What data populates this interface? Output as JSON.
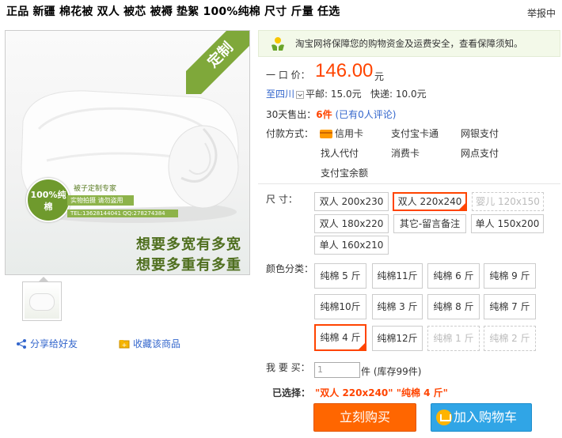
{
  "title": "正品 新疆 棉花被 双人 被芯 被褥 垫絮 100%纯棉 尺寸 斤量 任选",
  "report_link": "举报中",
  "image": {
    "ribbon": "定制",
    "badge": "100%纯棉",
    "brand_line1": "被子定制专家",
    "brand_line2": "实物拍摄 请勿盗用",
    "brand_line3": "TEL:13628144041 QQ:278274384",
    "slogan1": "想要多宽有多宽",
    "slogan2": "想要多重有多重"
  },
  "share": "分享给好友",
  "favorite": "收藏该商品",
  "guarantee": "淘宝网将保障您的购物资金及运费安全，查看保障须知。",
  "price": {
    "label": "一 口 价：",
    "value": "146.00",
    "unit": "元"
  },
  "shipping": {
    "to": "至四川",
    "regular": "平邮: 15.0元",
    "express": "快递: 10.0元"
  },
  "sales": {
    "prefix": "30天售出：",
    "count": "6件",
    "comments": "(已有0人评论)"
  },
  "payment": {
    "label": "付款方式：",
    "methods": [
      "信用卡",
      "支付宝卡通",
      "网银支付",
      "找人代付",
      "消费卡",
      "网点支付",
      "支付宝余额"
    ]
  },
  "size": {
    "label": "尺    寸：",
    "options": [
      "双人 200x230",
      "双人 220x240",
      "婴儿 120x150",
      "双人 180x220",
      "其它-留言备注",
      "单人 150x200",
      "单人 160x210"
    ]
  },
  "color": {
    "label": "颜色分类：",
    "options": [
      "纯棉 5 斤",
      "纯棉11斤",
      "纯棉 6 斤",
      "纯棉 9 斤",
      "纯棉10斤",
      "纯棉 3 斤",
      "纯棉 8 斤",
      "纯棉 7 斤",
      "纯棉 4 斤",
      "纯棉12斤",
      "纯棉 1 斤",
      "纯棉 2 斤"
    ]
  },
  "quantity": {
    "label": "我 要 买：",
    "value": "1",
    "stock": "件 (库存99件)"
  },
  "selected": {
    "label": "已选择：",
    "value": "\"双人  220x240\" \"纯棉  4 斤\""
  },
  "buttons": {
    "buy": "立刻购买",
    "cart": "加入购物车"
  },
  "colors": {
    "accent": "#ff4400",
    "buy_button": "#ff6600",
    "cart_button": "#30a5e6",
    "link": "#3366cc",
    "brand_green": "#6f9a2d"
  }
}
